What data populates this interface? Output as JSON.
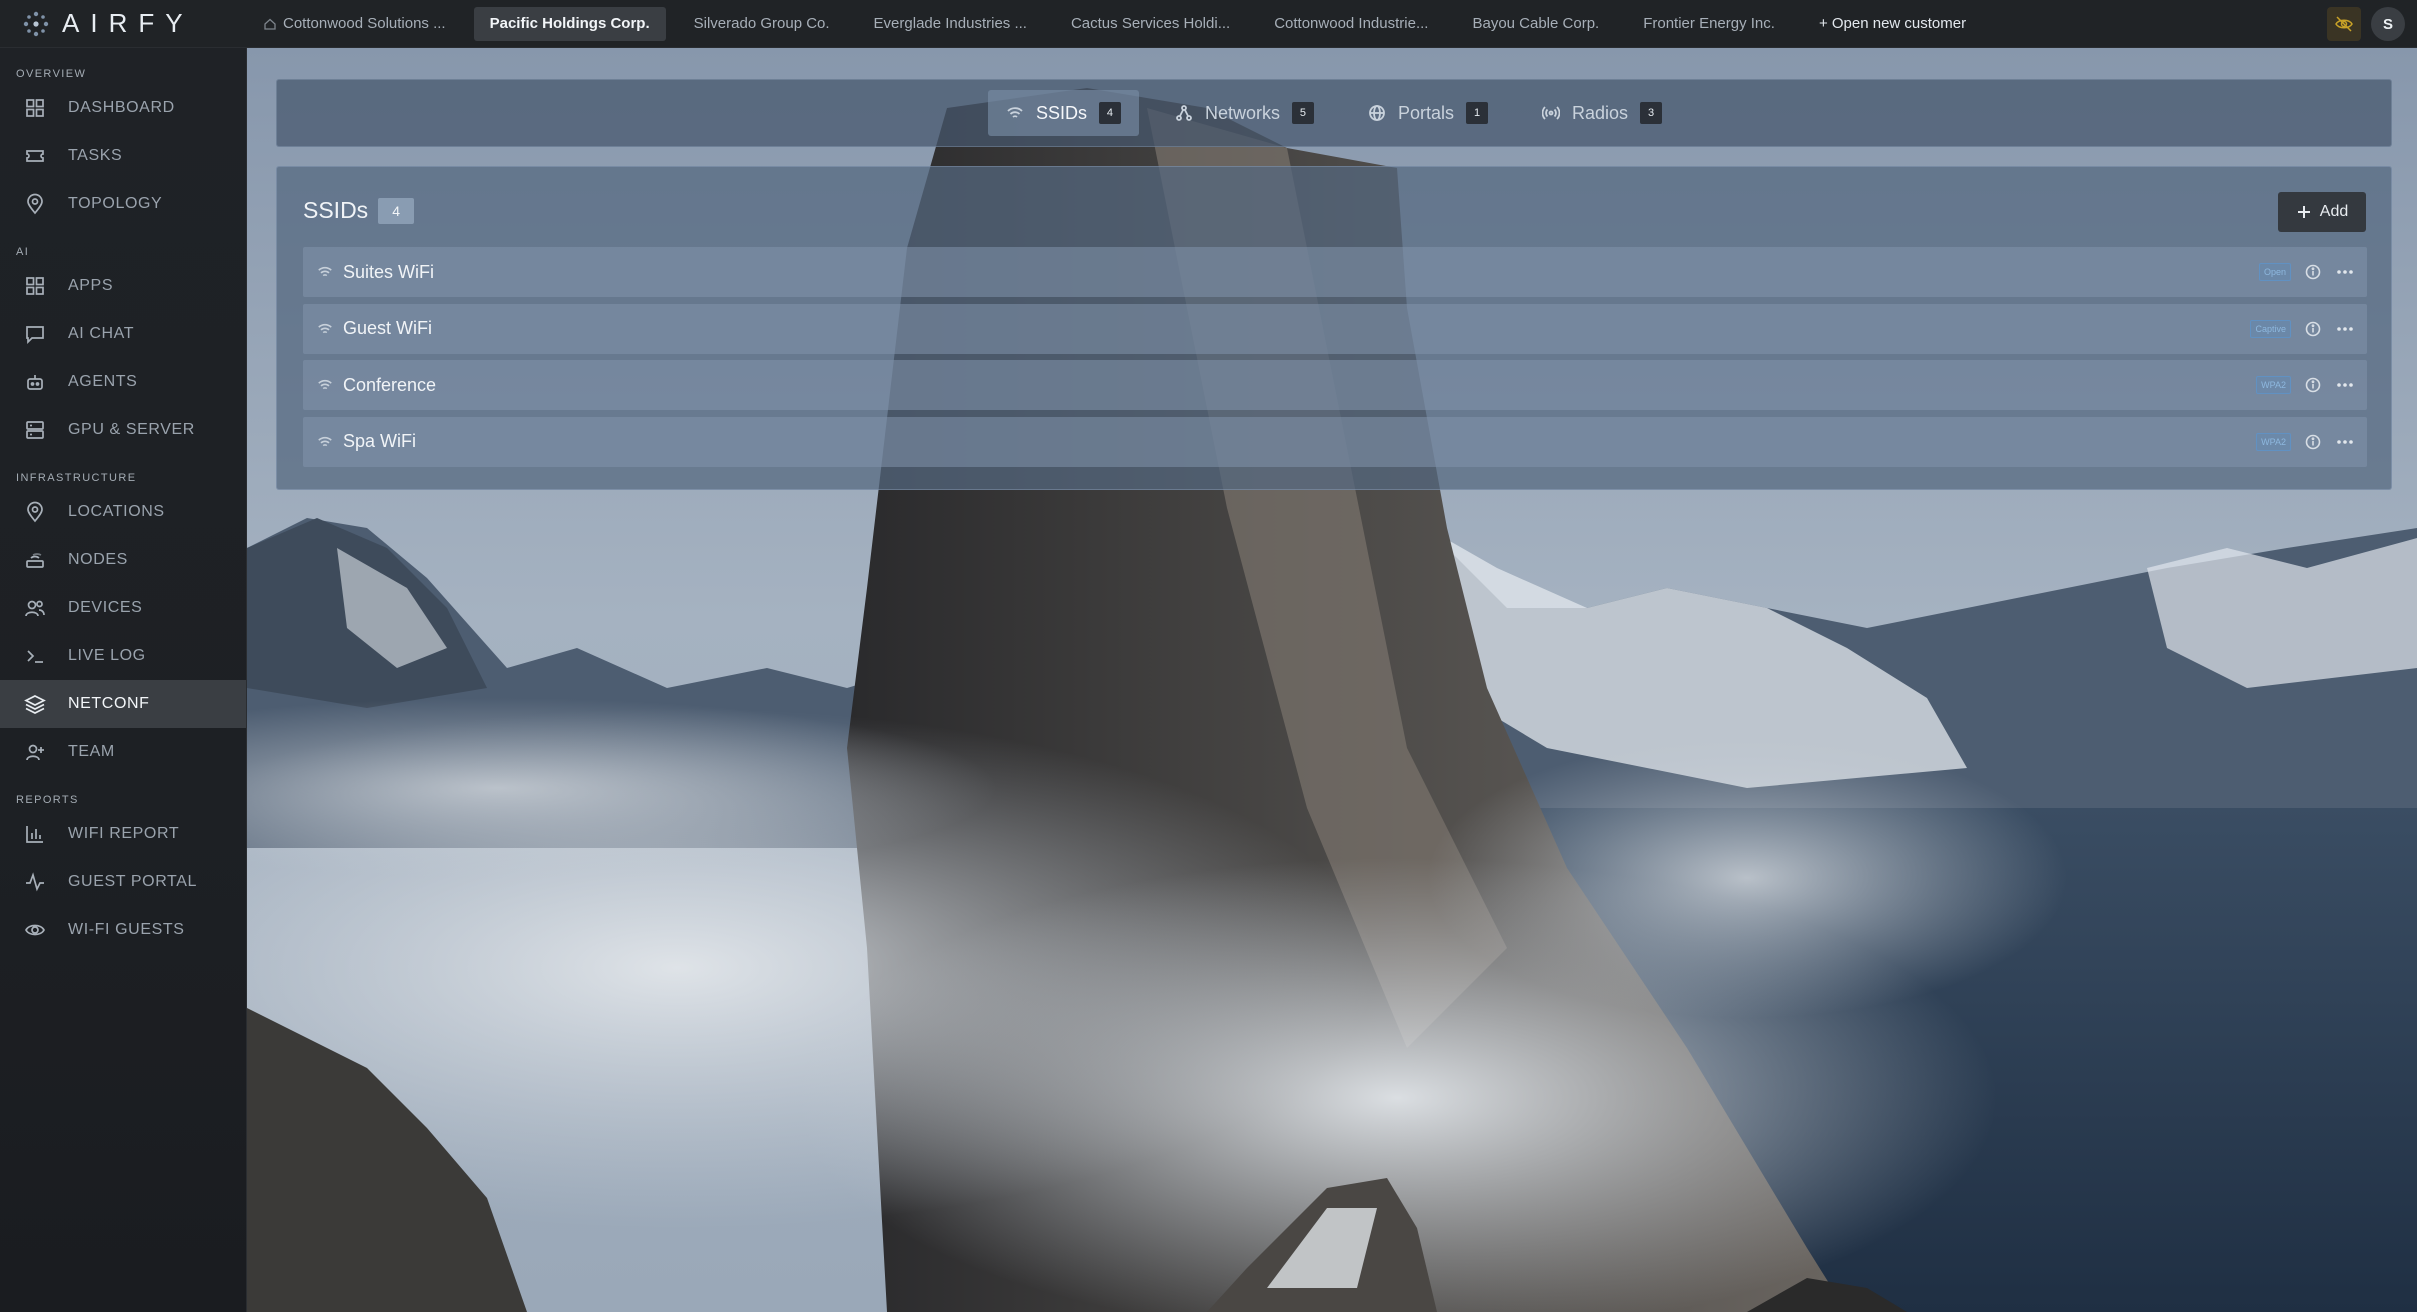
{
  "brand": {
    "name": "AIRFY"
  },
  "customer_tabs": [
    {
      "label": "Cottonwood Solutions ...",
      "active": false,
      "home": true
    },
    {
      "label": "Pacific Holdings Corp.",
      "active": true
    },
    {
      "label": "Silverado Group Co.",
      "active": false
    },
    {
      "label": "Everglade Industries ...",
      "active": false
    },
    {
      "label": "Cactus Services Holdi...",
      "active": false
    },
    {
      "label": "Cottonwood Industrie...",
      "active": false
    },
    {
      "label": "Bayou Cable Corp.",
      "active": false
    },
    {
      "label": "Frontier Energy Inc.",
      "active": false
    }
  ],
  "open_new_customer": "+ Open new customer",
  "user": {
    "initial": "S"
  },
  "sidebar": {
    "overview_title": "OVERVIEW",
    "overview": [
      {
        "label": "DASHBOARD",
        "icon": "grid-icon"
      },
      {
        "label": "TASKS",
        "icon": "ticket-icon"
      },
      {
        "label": "TOPOLOGY",
        "icon": "map-pin-icon"
      }
    ],
    "ai_title": "AI",
    "ai": [
      {
        "label": "APPS",
        "icon": "grid-icon"
      },
      {
        "label": "AI CHAT",
        "icon": "chat-icon"
      },
      {
        "label": "AGENTS",
        "icon": "robot-icon"
      },
      {
        "label": "GPU & SERVER",
        "icon": "server-icon"
      }
    ],
    "infra_title": "INFRASTRUCTURE",
    "infra": [
      {
        "label": "LOCATIONS",
        "icon": "map-pin-icon"
      },
      {
        "label": "NODES",
        "icon": "router-icon"
      },
      {
        "label": "DEVICES",
        "icon": "users-icon"
      },
      {
        "label": "LIVE LOG",
        "icon": "terminal-icon"
      },
      {
        "label": "NETCONF",
        "icon": "layers-icon",
        "active": true
      },
      {
        "label": "TEAM",
        "icon": "user-plus-icon"
      }
    ],
    "reports_title": "REPORTS",
    "reports": [
      {
        "label": "WIFI REPORT",
        "icon": "bar-chart-icon"
      },
      {
        "label": "GUEST PORTAL",
        "icon": "activity-icon"
      },
      {
        "label": "WI-FI GUESTS",
        "icon": "eye-icon"
      }
    ]
  },
  "subtabs": [
    {
      "label": "SSIDs",
      "count": "4",
      "active": true,
      "icon": "wifi-icon"
    },
    {
      "label": "Networks",
      "count": "5",
      "active": false,
      "icon": "network-icon"
    },
    {
      "label": "Portals",
      "count": "1",
      "active": false,
      "icon": "globe-icon"
    },
    {
      "label": "Radios",
      "count": "3",
      "active": false,
      "icon": "radio-icon"
    }
  ],
  "ssids_panel": {
    "title": "SSIDs",
    "count": "4",
    "add_label": "Add",
    "rows": [
      {
        "name": "Suites WiFi",
        "tag": "Open"
      },
      {
        "name": "Guest WiFi",
        "tag": "Captive"
      },
      {
        "name": "Conference",
        "tag": "WPA2"
      },
      {
        "name": "Spa WiFi",
        "tag": "WPA2"
      }
    ]
  }
}
